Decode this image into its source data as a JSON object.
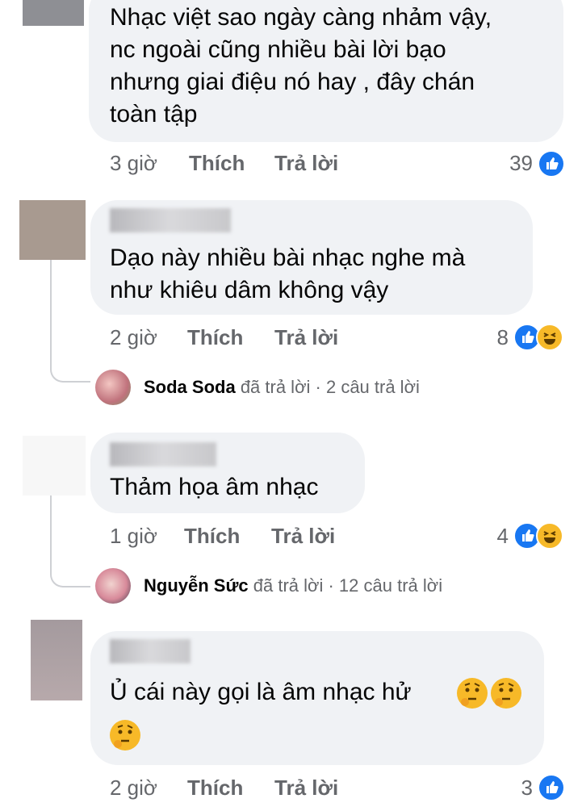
{
  "comments": [
    {
      "text_lines": [
        "Nhạc việt sao ngày càng nhảm vậy,",
        "nc ngoài cũng nhiều bài lời bạo",
        "nhưng giai điệu nó hay , đây chán",
        "toàn tập"
      ],
      "time": "3 giờ",
      "like_label": "Thích",
      "reply_label": "Trả lời",
      "reaction_count": "39",
      "reactions": [
        "like"
      ]
    },
    {
      "text_lines": [
        "Dạo này nhiều bài nhạc nghe mà",
        "như khiêu dâm không vậy"
      ],
      "time": "2 giờ",
      "like_label": "Thích",
      "reply_label": "Trả lời",
      "reaction_count": "8",
      "reactions": [
        "like",
        "haha"
      ],
      "replies_summary": {
        "name": "Soda Soda",
        "verb": "đã trả lời",
        "sep": "·",
        "count_text": "2 câu trả lời"
      }
    },
    {
      "text_lines": [
        "Thảm họa âm nhạc"
      ],
      "time": "1 giờ",
      "like_label": "Thích",
      "reply_label": "Trả lời",
      "reaction_count": "4",
      "reactions": [
        "like",
        "haha"
      ],
      "replies_summary": {
        "name": "Nguyễn Sức",
        "verb": "đã trả lời",
        "sep": "·",
        "count_text": "12 câu trả lời"
      }
    },
    {
      "text_lines": [
        "Ủ cái này gọi là âm nhạc hử",
        ""
      ],
      "time": "2 giờ",
      "like_label": "Thích",
      "reply_label": "Trả lời",
      "reaction_count": "3",
      "reactions": [
        "like"
      ],
      "emojis": [
        "thinking",
        "thinking",
        "thinking"
      ]
    }
  ],
  "colors": {
    "bubble": "#f0f2f5",
    "like": "#1877f2",
    "haha": "#f7b928",
    "meta": "#65676b"
  }
}
